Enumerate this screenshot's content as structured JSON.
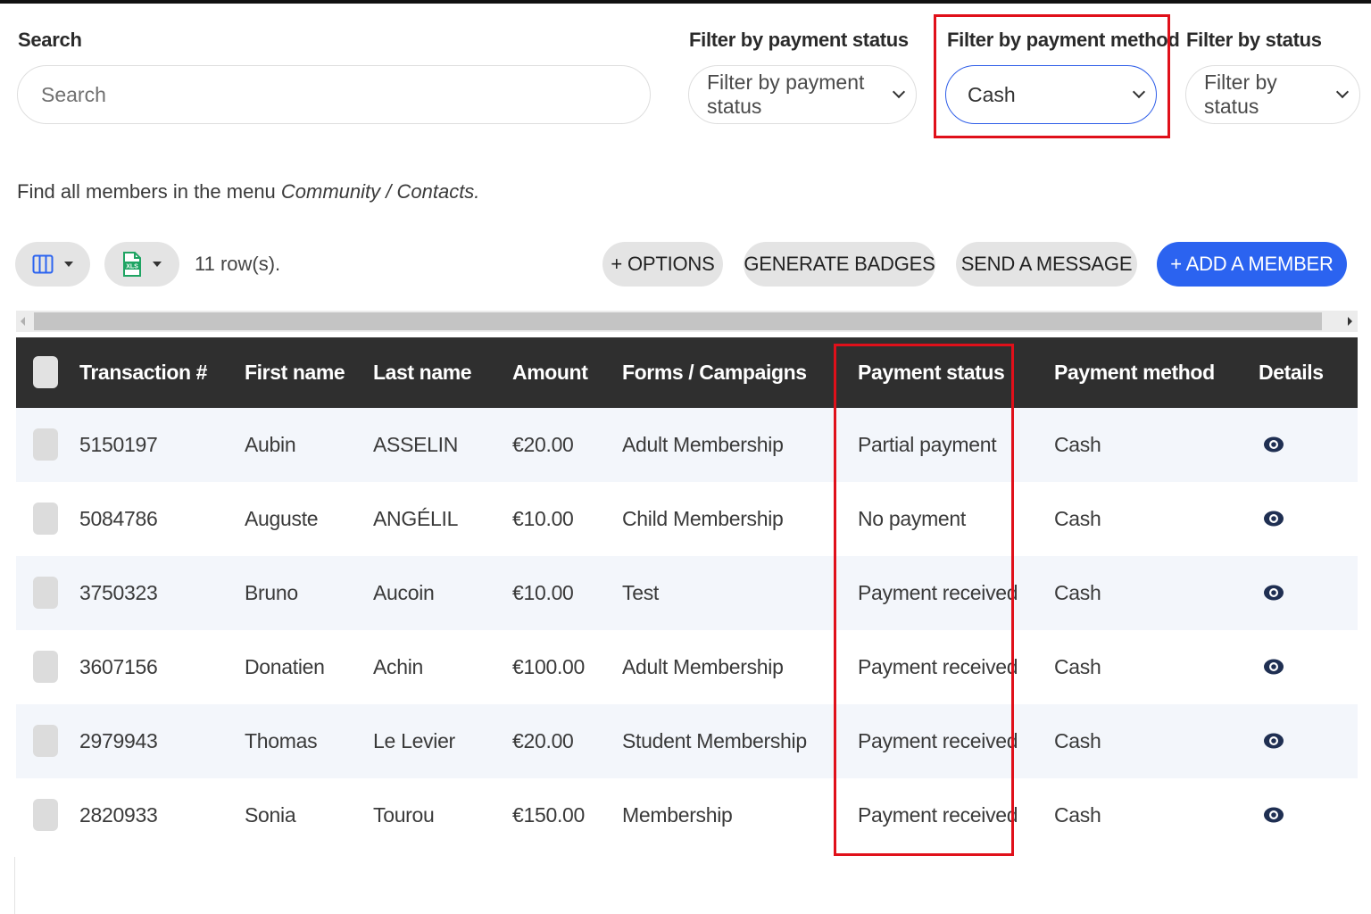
{
  "filters": {
    "search_label": "Search",
    "search_placeholder": "Search",
    "payment_status_label": "Filter by payment status",
    "payment_status_value": "Filter by payment status",
    "payment_method_label": "Filter by payment method",
    "payment_method_value": "Cash",
    "status_label": "Filter by status",
    "status_value": "Filter by status"
  },
  "hint": {
    "prefix": "Find all members in the menu ",
    "link": "Community / Contacts."
  },
  "toolbar": {
    "columns_icon": "columns-icon",
    "export_icon": "xls-file-icon",
    "rows_count": "11 row(s).",
    "options_label": "+ OPTIONS",
    "badges_label": "GENERATE BADGES",
    "message_label": "SEND A MESSAGE",
    "add_member_label": "+ ADD A MEMBER"
  },
  "table": {
    "headers": [
      "Transaction #",
      "First name",
      "Last name",
      "Amount",
      "Forms / Campaigns",
      "Payment status",
      "Payment method",
      "Details"
    ],
    "rows": [
      {
        "transaction": "5150197",
        "first": "Aubin",
        "last": "ASSELIN",
        "amount": "€20.00",
        "form": "Adult Membership",
        "status": "Partial payment",
        "method": "Cash"
      },
      {
        "transaction": "5084786",
        "first": "Auguste",
        "last": "ANGÉLIL",
        "amount": "€10.00",
        "form": "Child Membership",
        "status": "No payment",
        "method": "Cash"
      },
      {
        "transaction": "3750323",
        "first": "Bruno",
        "last": "Aucoin",
        "amount": "€10.00",
        "form": "Test",
        "status": "Payment received",
        "method": "Cash"
      },
      {
        "transaction": "3607156",
        "first": "Donatien",
        "last": "Achin",
        "amount": "€100.00",
        "form": "Adult Membership",
        "status": "Payment received",
        "method": "Cash"
      },
      {
        "transaction": "2979943",
        "first": "Thomas",
        "last": "Le Levier",
        "amount": "€20.00",
        "form": "Student Membership",
        "status": "Payment received",
        "method": "Cash"
      },
      {
        "transaction": "2820933",
        "first": "Sonia",
        "last": "Tourou",
        "amount": "€150.00",
        "form": "Membership",
        "status": "Payment received",
        "method": "Cash"
      }
    ],
    "details_icon": "eye-icon"
  },
  "colors": {
    "accent": "#2b63f0",
    "highlight": "#e0101a",
    "header_bg": "#2f2f2f",
    "row_alt_bg": "#f3f6fb"
  }
}
